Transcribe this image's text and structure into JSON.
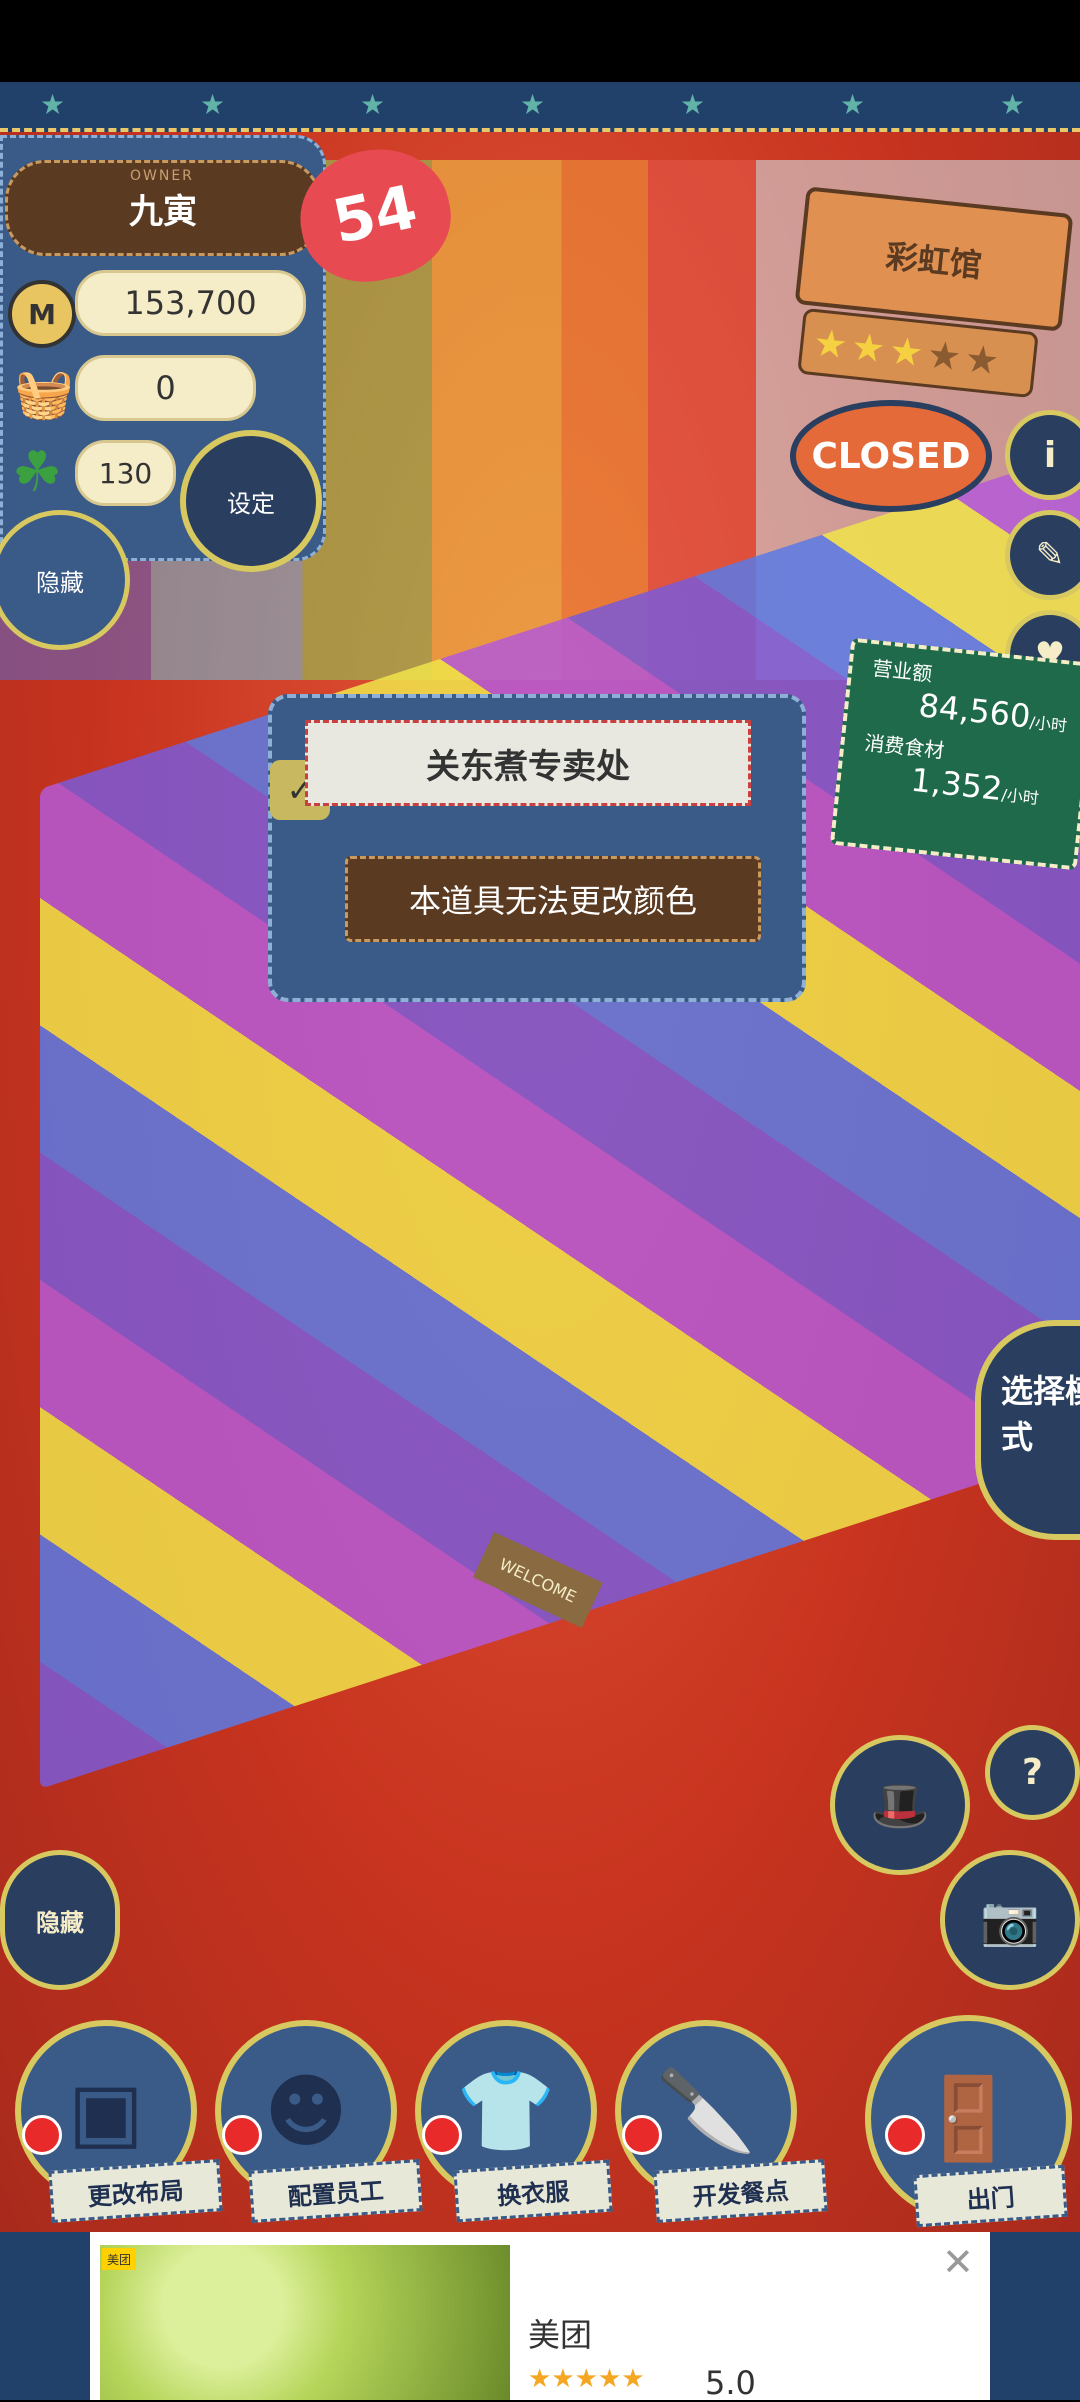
{
  "owner": {
    "label": "OWNER",
    "name": "九寅",
    "level": "54",
    "coins": "153,700",
    "ingredients": "0",
    "clovers": "130",
    "settings_label": "设定",
    "hide_label": "隐藏"
  },
  "shop": {
    "name": "彩虹馆",
    "stars": [
      true,
      true,
      true,
      false,
      false
    ],
    "status": "CLOSED",
    "info_icon": "i"
  },
  "sales": {
    "revenue_label": "营业额",
    "revenue_value": "84,560",
    "revenue_unit": "/小时",
    "consumption_label": "消费食材",
    "consumption_value": "1,352",
    "consumption_unit": "/小时"
  },
  "popup": {
    "title": "关东煮专卖处",
    "message": "本道具无法更改颜色"
  },
  "floor": {
    "welcome_mat": "WELCOME"
  },
  "right_controls": {
    "help_label": "?",
    "select_mode_label": "选择模式"
  },
  "left_controls": {
    "hide_label": "隐藏"
  },
  "bottom_menu": [
    {
      "label": "更改布局"
    },
    {
      "label": "配置员工"
    },
    {
      "label": "换衣服"
    },
    {
      "label": "开发餐点"
    },
    {
      "label": "出门"
    }
  ],
  "ad": {
    "brand_badge": "美团",
    "title": "美团",
    "stars": "★★★★★",
    "rating": "5.0",
    "close": "✕"
  },
  "colors": {
    "denim": "#3a5b88",
    "stitch": "#d8c860",
    "wood": "#5b3a22",
    "heart": "#e84a52",
    "closed": "#e46a3a"
  }
}
